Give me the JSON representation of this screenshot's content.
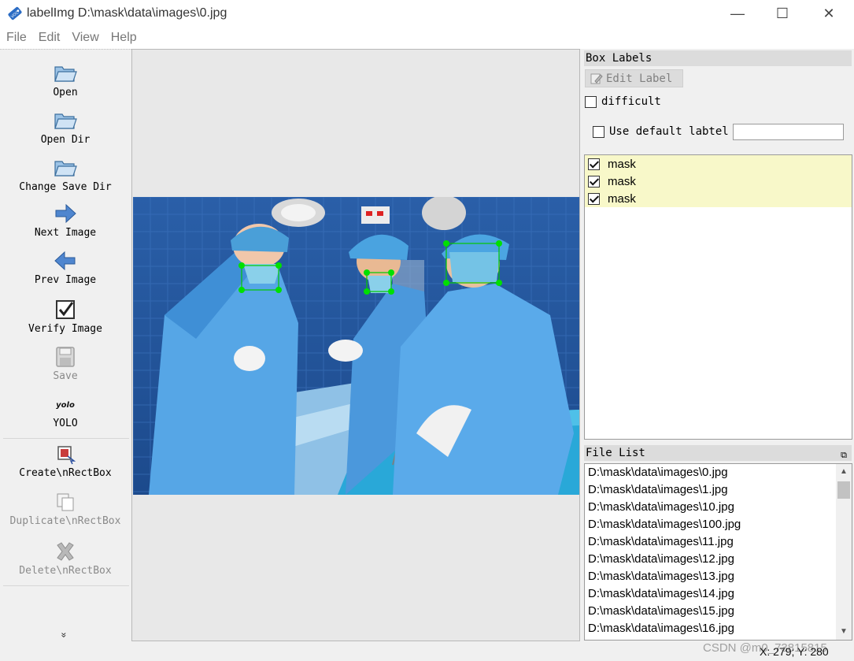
{
  "window": {
    "title": "labelImg D:\\mask\\data\\images\\0.jpg",
    "app_icon_text": "VOC",
    "minimize": "—",
    "maximize": "☐",
    "close": "✕"
  },
  "menu": [
    "File",
    "Edit",
    "View",
    "Help"
  ],
  "toolbar": {
    "open": "Open",
    "open_dir": "Open Dir",
    "change_save_dir": "Change Save Dir",
    "next_image": "Next Image",
    "prev_image": "Prev Image",
    "verify_image": "Verify Image",
    "save": "Save",
    "yolo_icon_text": "yolo",
    "yolo": "YOLO",
    "create_rect_box": "Create\\nRectBox",
    "duplicate_rect_box": "Duplicate\\nRectBox",
    "delete_rect_box": "Delete\\nRectBox",
    "more": "»"
  },
  "box_labels": {
    "title": "Box Labels",
    "edit_label": "Edit Label",
    "difficult": "difficult",
    "use_default_label": "Use default labtel",
    "default_label_value": "",
    "items": [
      {
        "label": "mask",
        "checked": true
      },
      {
        "label": "mask",
        "checked": true
      },
      {
        "label": "mask",
        "checked": true
      }
    ]
  },
  "file_list": {
    "title": "File List",
    "float_icon": "⧉",
    "files": [
      "D:\\mask\\data\\images\\0.jpg",
      "D:\\mask\\data\\images\\1.jpg",
      "D:\\mask\\data\\images\\10.jpg",
      "D:\\mask\\data\\images\\100.jpg",
      "D:\\mask\\data\\images\\11.jpg",
      "D:\\mask\\data\\images\\12.jpg",
      "D:\\mask\\data\\images\\13.jpg",
      "D:\\mask\\data\\images\\14.jpg",
      "D:\\mask\\data\\images\\15.jpg",
      "D:\\mask\\data\\images\\16.jpg"
    ]
  },
  "status": {
    "coords": "X: 279; Y: 280",
    "watermark": "CSDN @m0_73815815"
  },
  "colors": {
    "label_bg": "#f8f8c9",
    "box_vertex": "#00e000",
    "box_edge": "#00c800",
    "scrub_blue": "#3f8fd6"
  }
}
